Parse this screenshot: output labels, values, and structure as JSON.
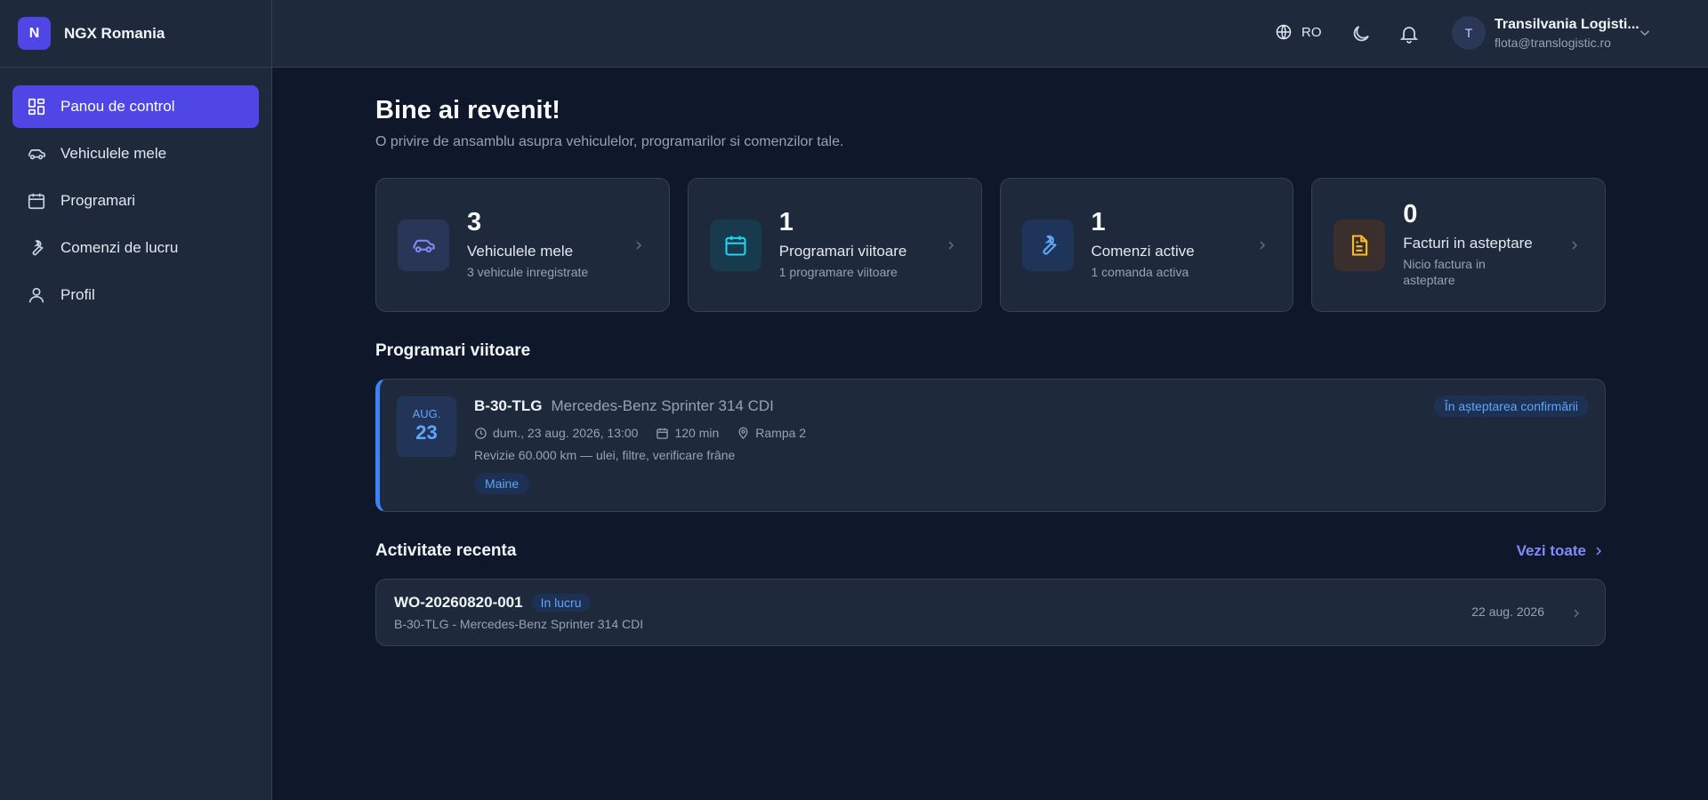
{
  "brand": {
    "logo_letter": "N",
    "name": "NGX Romania"
  },
  "sidebar": {
    "items": [
      {
        "label": "Panou de control",
        "icon": "dashboard-icon",
        "active": true
      },
      {
        "label": "Vehiculele mele",
        "icon": "car-icon",
        "active": false
      },
      {
        "label": "Programari",
        "icon": "calendar-icon",
        "active": false
      },
      {
        "label": "Comenzi de lucru",
        "icon": "wrench-icon",
        "active": false
      },
      {
        "label": "Profil",
        "icon": "user-icon",
        "active": false
      }
    ]
  },
  "topbar": {
    "language": "RO",
    "user": {
      "initial": "T",
      "name": "Transilvania Logisti...",
      "email": "flota@translogistic.ro"
    }
  },
  "main": {
    "greeting": "Bine ai revenit!",
    "subtitle": "O privire de ansamblu asupra vehiculelor, programarilor si comenzilor tale.",
    "cards": [
      {
        "value": "3",
        "label": "Vehiculele mele",
        "sub": "3 vehicule inregistrate",
        "icon": "car-icon",
        "color": "#818cf8"
      },
      {
        "value": "1",
        "label": "Programari viitoare",
        "sub": "1 programare viitoare",
        "icon": "calendar-icon",
        "color": "#22d3ee"
      },
      {
        "value": "1",
        "label": "Comenzi active",
        "sub": "1 comanda activa",
        "icon": "wrench-icon",
        "color": "#60a5fa"
      },
      {
        "value": "0",
        "label": "Facturi in asteptare",
        "sub": "Nicio factura in asteptare",
        "icon": "document-icon",
        "color": "#fbbf24"
      }
    ],
    "appointments_title": "Programari viitoare",
    "appointment": {
      "month": "AUG.",
      "day": "23",
      "plate": "B-30-TLG",
      "model": "Mercedes-Benz Sprinter 314 CDI",
      "datetime": "dum., 23 aug. 2026, 13:00",
      "duration": "120 min",
      "location": "Rampa 2",
      "description": "Revizie 60.000 km — ulei, filtre, verificare frâne",
      "tag": "Maine",
      "status": "În așteptarea confirmării"
    },
    "activity_title": "Activitate recenta",
    "see_all": "Vezi toate",
    "activity": {
      "order": "WO-20260820-001",
      "status": "In lucru",
      "vehicle": "B-30-TLG - Mercedes-Benz Sprinter 314 CDI",
      "date": "22 aug. 2026"
    }
  }
}
